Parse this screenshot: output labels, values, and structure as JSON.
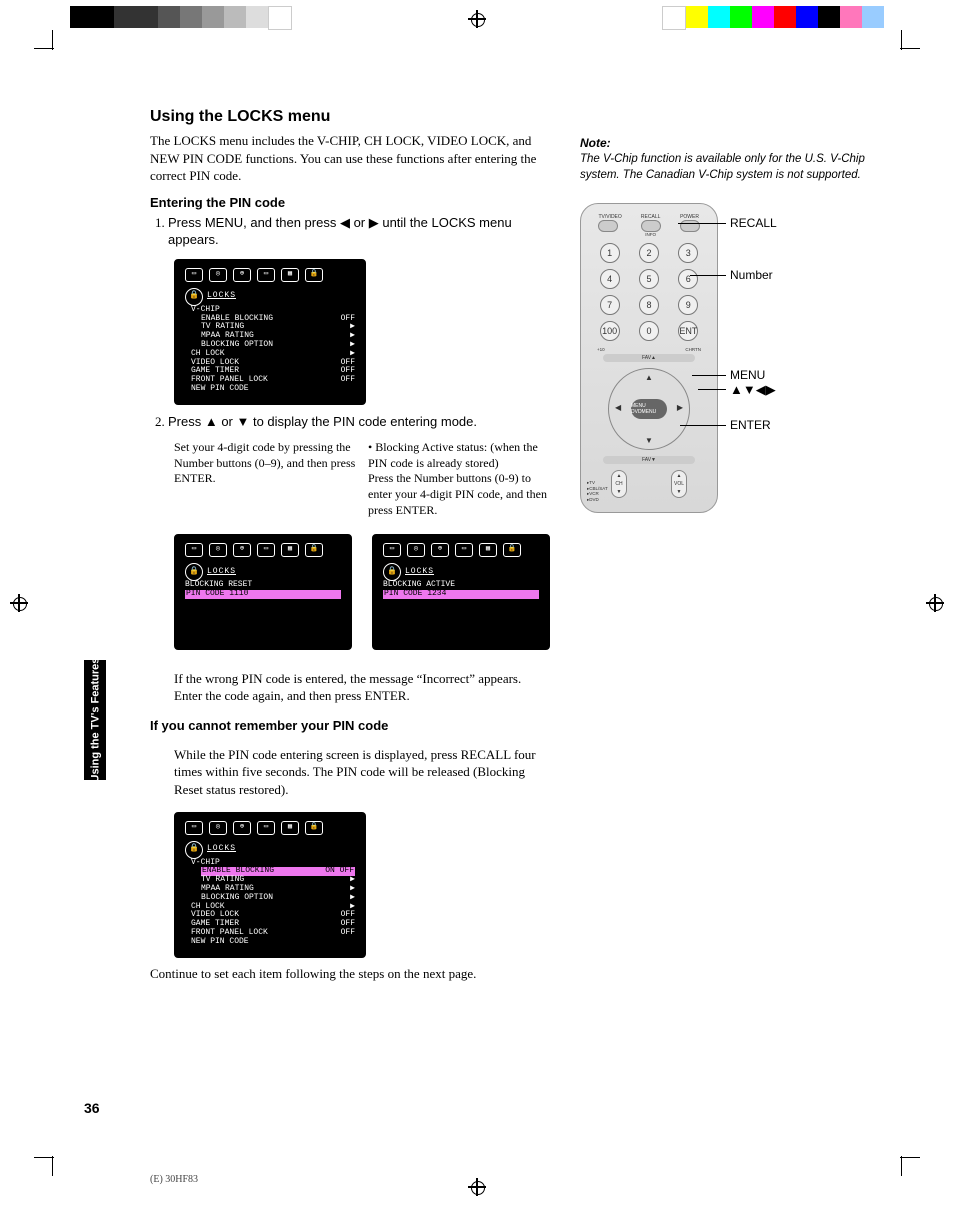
{
  "page_number": "36",
  "footer": "(E) 30HF83",
  "side_tab": "Using the TV's\nFeatures",
  "title": "Using the LOCKS menu",
  "intro": "The LOCKS menu includes the V-CHIP, CH LOCK, VIDEO LOCK, and NEW PIN CODE functions. You can use these functions after entering the correct PIN code.",
  "sub1": "Entering the PIN code",
  "step1": "Press MENU, and then press ◀ or ▶ until the LOCKS menu appears.",
  "screen1": {
    "title": "LOCKS",
    "lines": [
      {
        "l": "V-CHIP",
        "v": ""
      },
      {
        "l": "ENABLE BLOCKING",
        "v": "OFF",
        "sub": true
      },
      {
        "l": "TV RATING",
        "v": "▶",
        "sub": true
      },
      {
        "l": "MPAA RATING",
        "v": "▶",
        "sub": true
      },
      {
        "l": "BLOCKING OPTION",
        "v": "▶",
        "sub": true
      },
      {
        "l": "CH LOCK",
        "v": "▶"
      },
      {
        "l": "VIDEO LOCK",
        "v": "OFF"
      },
      {
        "l": "GAME TIMER",
        "v": "OFF"
      },
      {
        "l": "FRONT PANEL LOCK",
        "v": "OFF"
      },
      {
        "l": "NEW PIN CODE",
        "v": ""
      }
    ]
  },
  "step2": "Press ▲ or ▼ to display the PIN code entering mode.",
  "s2_left_head": "Set your 4-digit code by pressing the Number buttons (0–9), and then press ENTER.",
  "s2_right_head": "Blocking Active status: (when the PIN code is already stored)",
  "s2_right_body": "Press the Number buttons (0-9) to enter your 4-digit PIN code, and then press ENTER.",
  "screen2a": {
    "title": "LOCKS",
    "line1": "BLOCKING RESET",
    "line2": "PIN CODE 1110"
  },
  "screen2b": {
    "title": "LOCKS",
    "line1": "BLOCKING ACTIVE",
    "line2": "PIN CODE 1234"
  },
  "wrong_pin": "If the wrong PIN code is entered, the message “Incorrect” appears. Enter the code again, and then press ENTER.",
  "sub2": "If you cannot remember your PIN code",
  "forgot_body": "While the PIN code entering screen is displayed, press RECALL four times within five seconds. The PIN code will be released (Blocking Reset status restored).",
  "screen3": {
    "title": "LOCKS",
    "lines": [
      {
        "l": "V-CHIP",
        "v": ""
      },
      {
        "l": "ENABLE BLOCKING",
        "v": "ON OFF",
        "sub": true,
        "hilite": true
      },
      {
        "l": "TV RATING",
        "v": "▶",
        "sub": true
      },
      {
        "l": "MPAA RATING",
        "v": "▶",
        "sub": true
      },
      {
        "l": "BLOCKING OPTION",
        "v": "▶",
        "sub": true
      },
      {
        "l": "CH LOCK",
        "v": "▶"
      },
      {
        "l": "VIDEO LOCK",
        "v": "OFF"
      },
      {
        "l": "GAME TIMER",
        "v": "OFF"
      },
      {
        "l": "FRONT PANEL LOCK",
        "v": "OFF"
      },
      {
        "l": "NEW PIN CODE",
        "v": ""
      }
    ]
  },
  "continue_text": "Continue to set each item following the steps on the next page.",
  "note_head": "Note:",
  "note_body": "The V-Chip function is available only for the U.S. V-Chip system. The Canadian V-Chip system is not supported.",
  "remote": {
    "top_labels": [
      "TV/VIDEO",
      "RECALL",
      "POWER"
    ],
    "info_label": "INFO",
    "numbers": [
      "1",
      "2",
      "3",
      "4",
      "5",
      "6",
      "7",
      "8",
      "9",
      "100",
      "0",
      "ENT"
    ],
    "small_labels": {
      "plus10": "+10",
      "chrtn": "CHRTN"
    },
    "fav_up": "FAV▲",
    "fav_down": "FAV▼",
    "center": "MENU\nDVDMENU",
    "side_modes": [
      "TV",
      "CBL/SAT",
      "VCR",
      "DVD"
    ],
    "bottom": [
      "CH",
      "VOL"
    ]
  },
  "callouts": {
    "recall": "RECALL",
    "number": "Number",
    "menu": "MENU",
    "arrows": "▲▼◀▶",
    "enter": "ENTER"
  },
  "chart_data": {
    "type": "table",
    "title": "LOCKS menu default values",
    "rows": [
      {
        "item": "ENABLE BLOCKING",
        "value": "OFF"
      },
      {
        "item": "VIDEO LOCK",
        "value": "OFF"
      },
      {
        "item": "GAME TIMER",
        "value": "OFF"
      },
      {
        "item": "FRONT PANEL LOCK",
        "value": "OFF"
      }
    ]
  },
  "colorbar_left": [
    "#000",
    "#000",
    "#333",
    "#333",
    "#555",
    "#777",
    "#999",
    "#bbb",
    "#ddd",
    "#fff"
  ],
  "colorbar_right": [
    "#fff",
    "#ff0",
    "#0ff",
    "#0f0",
    "#f0f",
    "#f00",
    "#00f",
    "#000",
    "#f7b",
    "#9cf"
  ]
}
